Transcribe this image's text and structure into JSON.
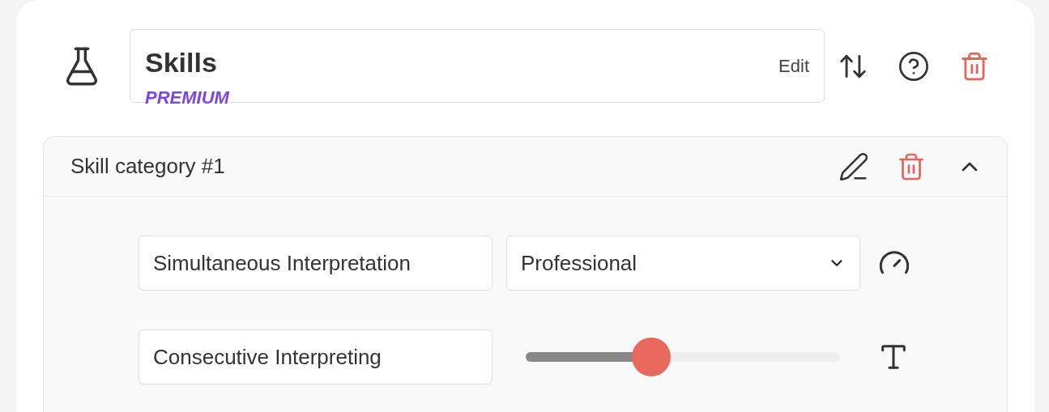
{
  "section": {
    "title": "Skills",
    "badge": "PREMIUM",
    "edit_label": "Edit"
  },
  "category": {
    "title": "Skill category #1",
    "expanded": true,
    "skills": [
      {
        "kind": "select",
        "name": "Simultaneous Interpretation",
        "level_text": "Professional"
      },
      {
        "kind": "slider",
        "name": "Consecutive Interpreting",
        "level": 0.4
      }
    ]
  }
}
